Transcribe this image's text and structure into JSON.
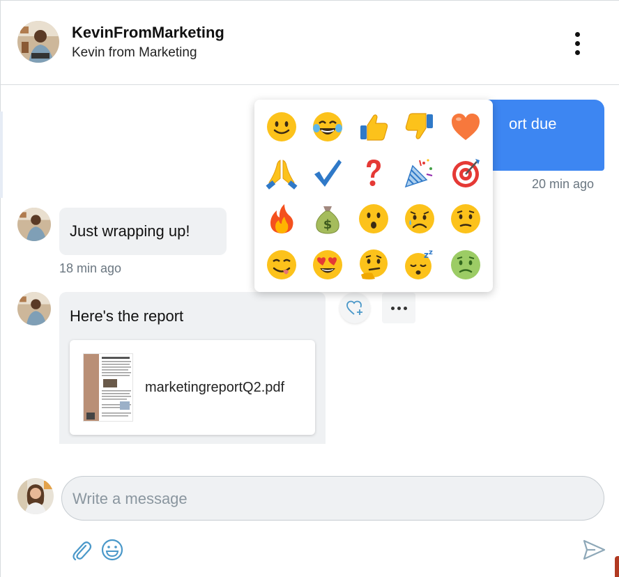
{
  "header": {
    "username": "KevinFromMarketing",
    "display_name": "Kevin from Marketing",
    "menu_icon": "kebab-menu-icon"
  },
  "conversation": {
    "outgoing": {
      "text_visible": "ort due",
      "timestamp": "20 min ago",
      "color": "#3d86f2"
    },
    "incoming": [
      {
        "text": "Just wrapping up!",
        "timestamp": "18 min ago"
      },
      {
        "text": "Here's the report",
        "attachment": {
          "filename": "marketingreportQ2.pdf",
          "icon": "pdf-thumbnail"
        }
      }
    ],
    "message_actions": {
      "react_icon": "heart-plus-icon",
      "more_icon": "more-horizontal-icon"
    }
  },
  "emoji_picker": {
    "emojis": [
      "slightly-smiling-face",
      "face-with-tears-of-joy",
      "thumbs-up",
      "thumbs-down",
      "orange-heart",
      "folded-hands",
      "check-mark",
      "red-question-mark",
      "party-popper",
      "direct-hit",
      "fire",
      "money-bag",
      "hushed-face",
      "sad-face",
      "worried-face",
      "face-savoring-food",
      "smiling-face-with-heart-eyes",
      "thinking-face",
      "sleeping-face",
      "nauseated-face"
    ]
  },
  "composer": {
    "placeholder": "Write a message",
    "attach_icon": "paperclip-icon",
    "emoji_icon": "smiley-icon",
    "send_icon": "send-icon",
    "accent": "#4a98c9"
  }
}
